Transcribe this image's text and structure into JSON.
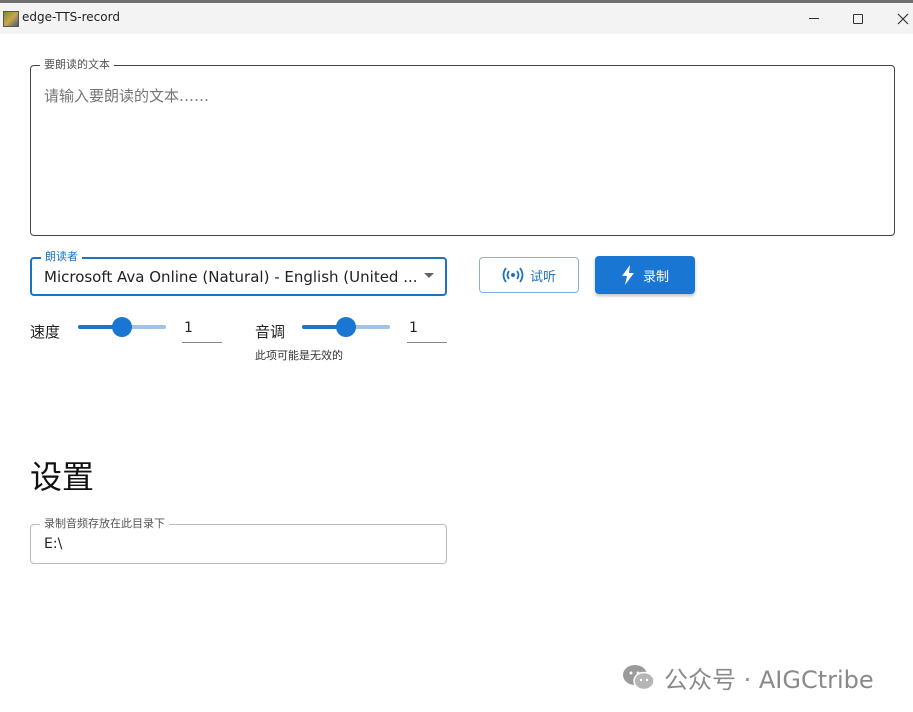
{
  "window": {
    "title": "edge-TTS-record"
  },
  "text_input": {
    "legend": "要朗读的文本",
    "placeholder": "请输入要朗读的文本……"
  },
  "voice": {
    "legend": "朗读者",
    "selected": "Microsoft Ava Online (Natural) - English (United ..."
  },
  "buttons": {
    "preview": "试听",
    "record": "录制"
  },
  "speed": {
    "label": "速度",
    "value": "1",
    "slider_fraction": 0.5
  },
  "pitch": {
    "label": "音调",
    "value": "1",
    "slider_fraction": 0.5,
    "hint": "此项可能是无效的"
  },
  "settings": {
    "title": "设置",
    "dir_legend": "录制音频存放在此目录下",
    "dir_value": "E:\\"
  },
  "watermark": {
    "text": "公众号 · AIGCtribe"
  },
  "colors": {
    "accent": "#1976d2",
    "track_light": "#9fc3e8"
  },
  "icons": [
    "app-icon",
    "minimize-icon",
    "maximize-icon",
    "close-icon",
    "broadcast-icon",
    "lightning-icon",
    "dropdown-arrow-icon",
    "wechat-icon"
  ]
}
